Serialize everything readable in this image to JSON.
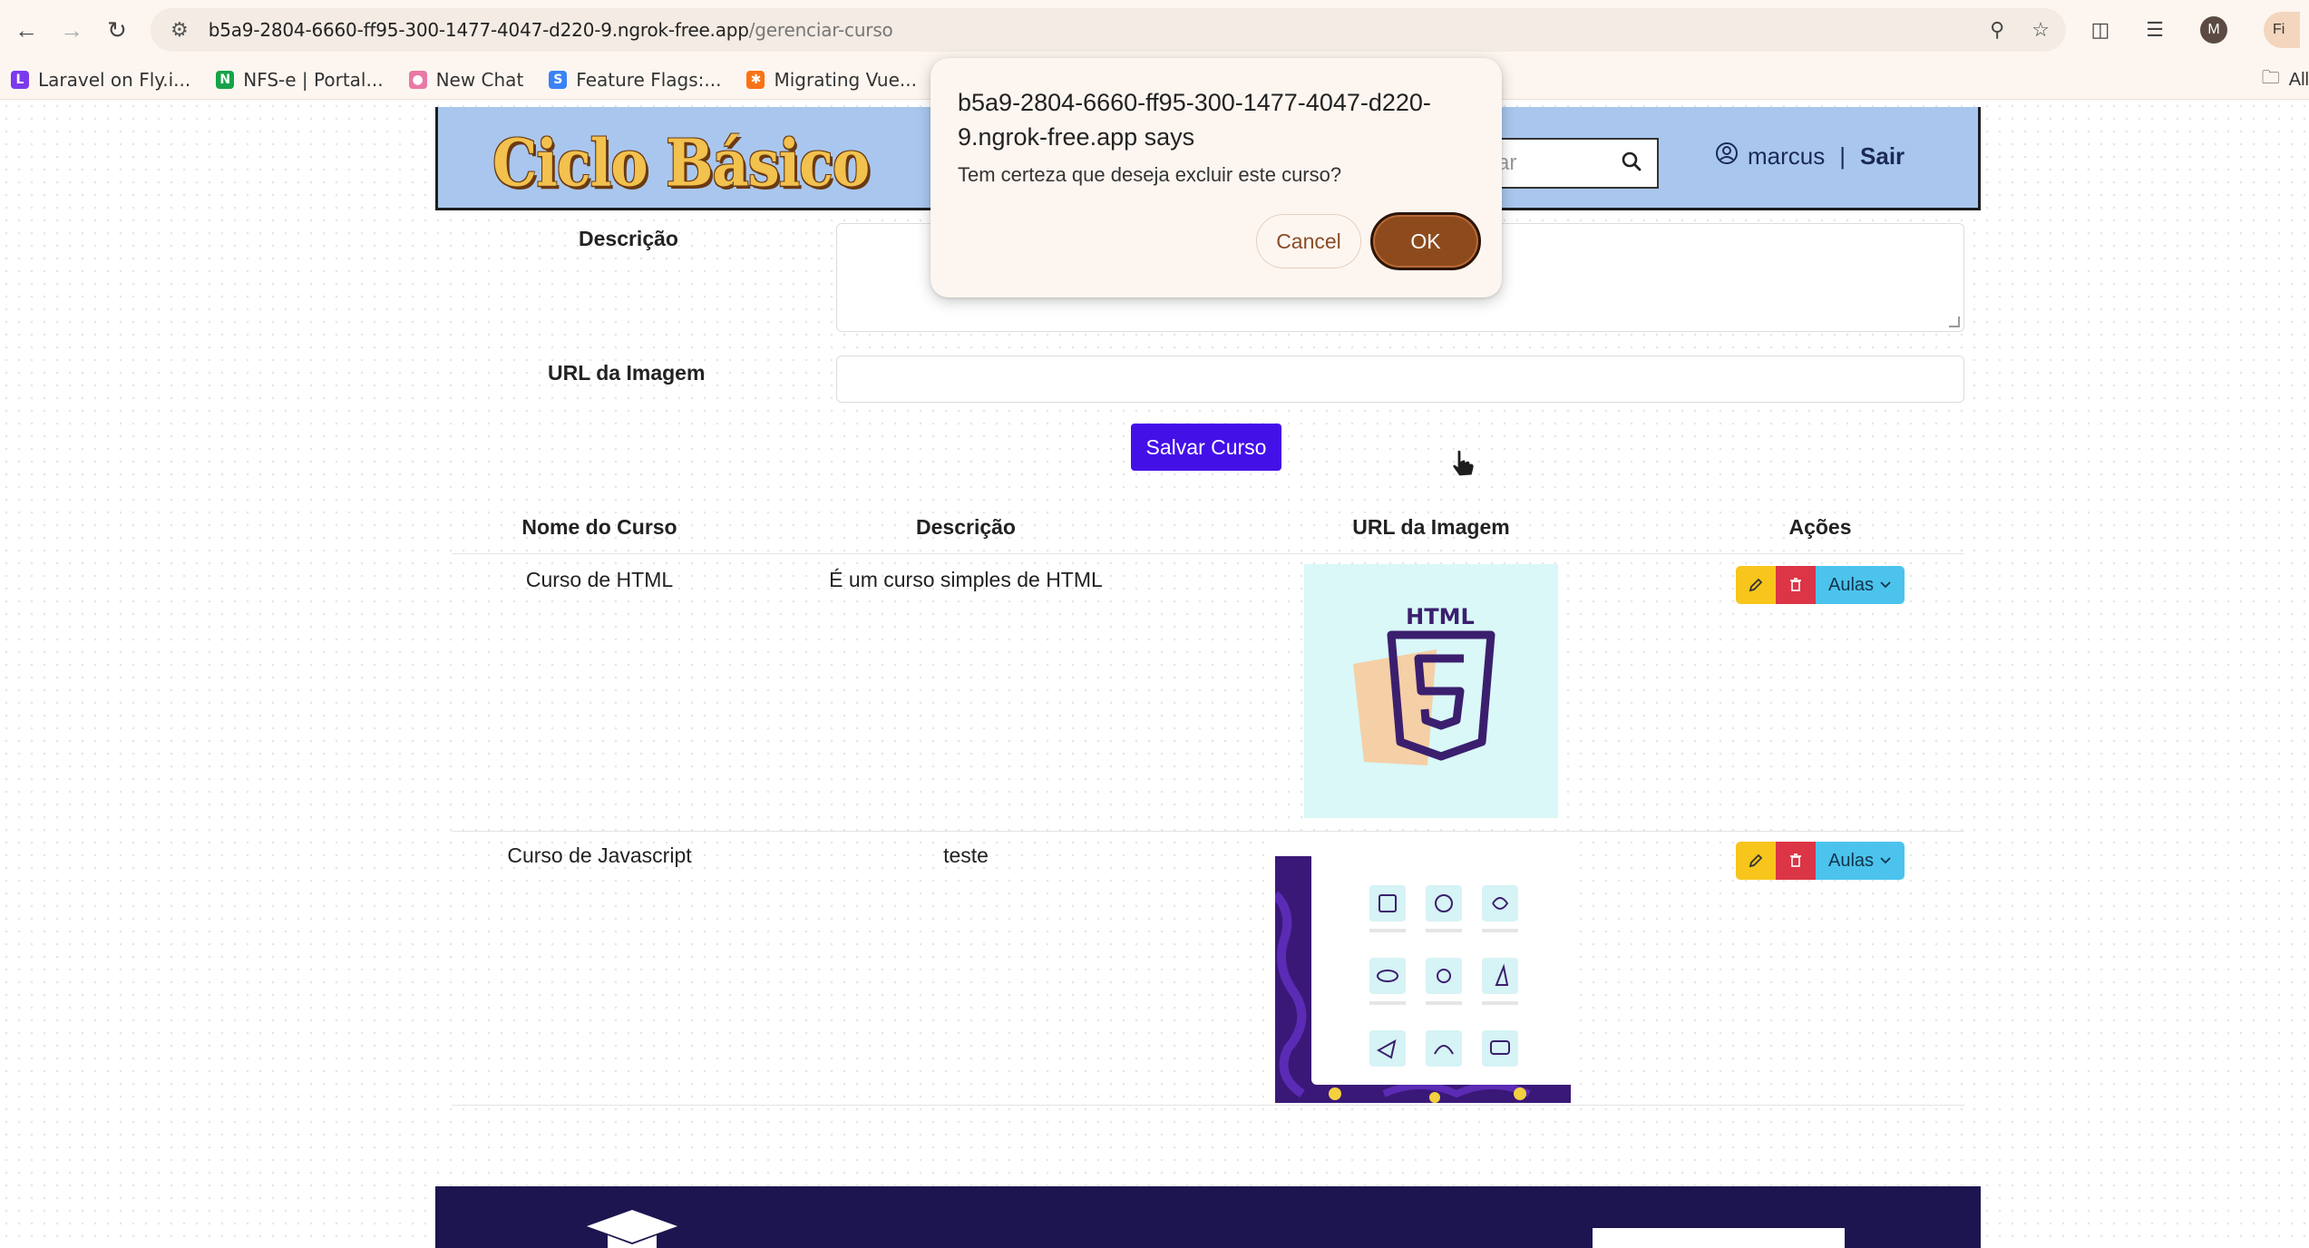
{
  "browser": {
    "url_host": "b5a9-2804-6660-ff95-300-1477-4047-d220-9.ngrok-free.app",
    "url_path": "/gerenciar-curso",
    "profile_initial": "M",
    "profile_chip_text": "Fi",
    "bookmarks": [
      {
        "label": "Laravel on Fly.i...",
        "icon": "laravel-favicon",
        "color": "#7c3aed"
      },
      {
        "label": "NFS-e | Portal...",
        "icon": "nfse-favicon",
        "color": "#16a34a"
      },
      {
        "label": "New Chat",
        "icon": "chat-favicon",
        "color": "#e879a6"
      },
      {
        "label": "Feature Flags:...",
        "icon": "feature-flags-favicon",
        "color": "#3b82f6"
      },
      {
        "label": "Migrating Vue...",
        "icon": "migrating-vue-favicon",
        "color": "#f97316"
      }
    ],
    "all_bookmarks_label": "All"
  },
  "header": {
    "logo_text": "Ciclo Básico",
    "search_placeholder": "sar",
    "user_name": "marcus",
    "separator": "|",
    "logout_label": "Sair"
  },
  "form": {
    "description_label": "Descrição",
    "image_url_label": "URL da Imagem",
    "save_button": "Salvar Curso"
  },
  "table": {
    "headers": [
      "Nome do Curso",
      "Descrição",
      "URL da Imagem",
      "Ações"
    ],
    "rows": [
      {
        "name": "Curso de HTML",
        "description": "É um curso simples de HTML",
        "image_caption": "HTML",
        "lessons_label": "Aulas"
      },
      {
        "name": "Curso de Javascript",
        "description": "teste",
        "image_caption": "",
        "lessons_label": "Aulas"
      }
    ]
  },
  "dialog": {
    "title": "b5a9-2804-6660-ff95-300-1477-4047-d220-9.ngrok-free.app says",
    "message": "Tem certeza que deseja excluir este curso?",
    "cancel_label": "Cancel",
    "ok_label": "OK"
  },
  "colors": {
    "header_bg": "#a9c7ee",
    "save_button": "#4410e8",
    "edit_button": "#f7c51b",
    "delete_button": "#dc3545",
    "lessons_button": "#4cc3ed",
    "footer_bg": "#1c1550",
    "ok_button": "#8d4b1d"
  }
}
